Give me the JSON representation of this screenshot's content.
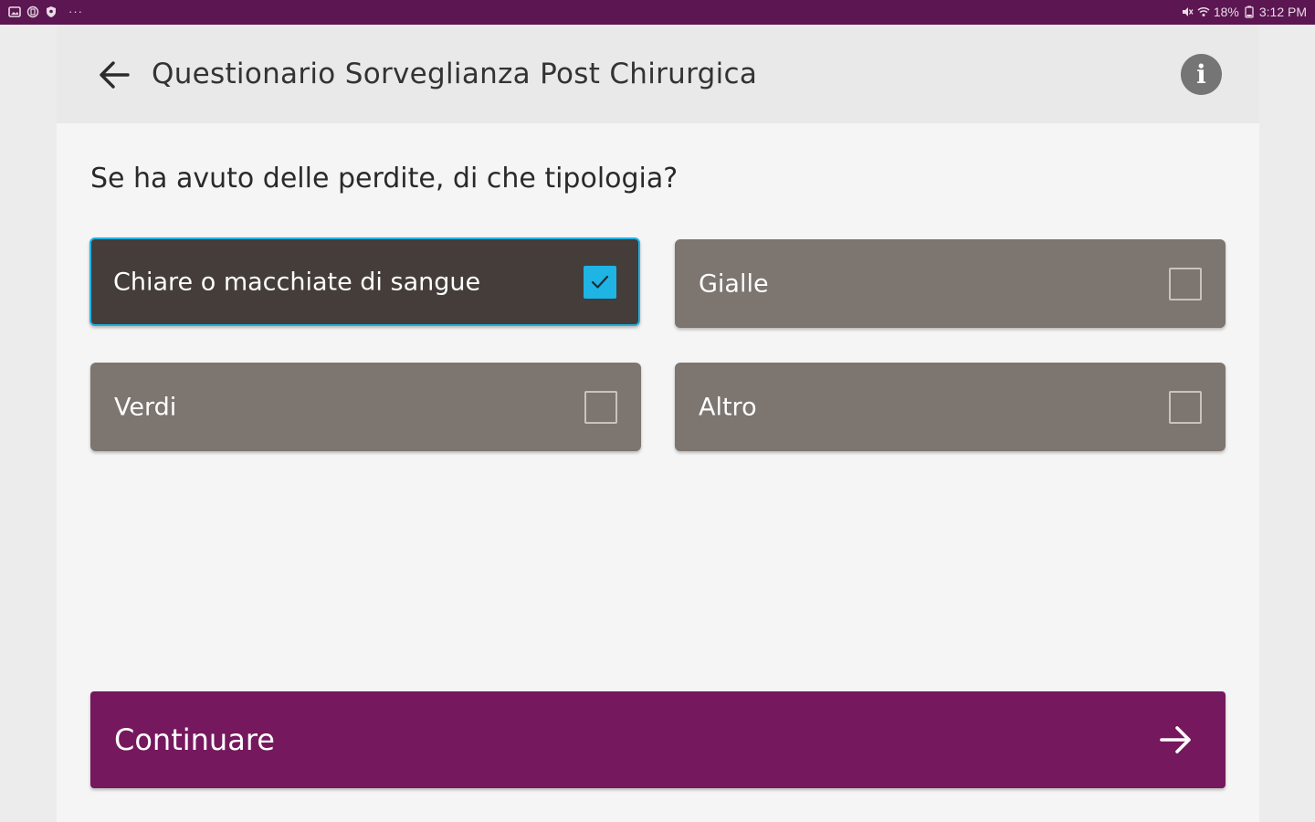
{
  "status_bar": {
    "left_icons": [
      "gallery-icon",
      "sim-icon",
      "shield-icon"
    ],
    "overflow": "···",
    "battery_text": "18%",
    "time": "3:12 PM"
  },
  "header": {
    "title": "Questionario Sorveglianza Post Chirurgica",
    "info_glyph": "i"
  },
  "question": {
    "text": "Se ha avuto delle perdite, di che tipologia?"
  },
  "options": [
    {
      "label": "Chiare o macchiate di sangue",
      "checked": true
    },
    {
      "label": "Gialle",
      "checked": false
    },
    {
      "label": "Verdi",
      "checked": false
    },
    {
      "label": "Altro",
      "checked": false
    }
  ],
  "continue_button": {
    "label": "Continuare"
  },
  "colors": {
    "status_bar": "#5c1652",
    "primary": "#75185d",
    "accent": "#1eb4e4",
    "option_default": "#7c7570",
    "option_selected": "#443d39"
  }
}
